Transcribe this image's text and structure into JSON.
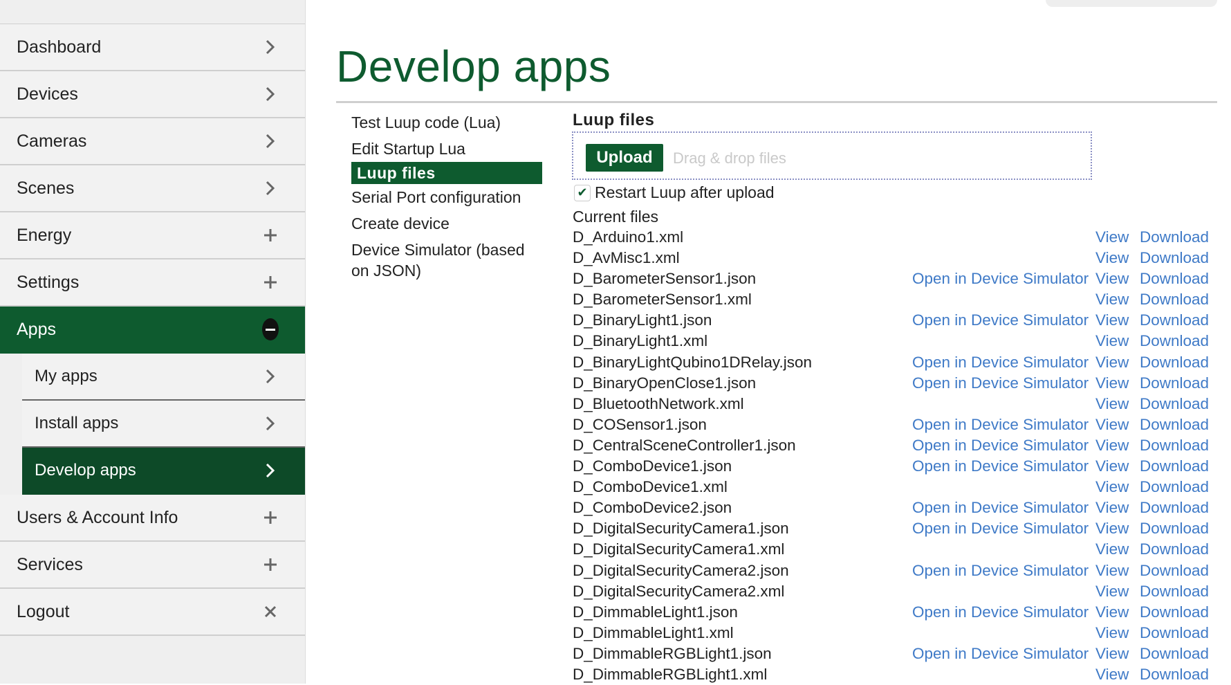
{
  "sidebar": {
    "items": [
      {
        "label": "Dashboard",
        "icon": "chevron-right-icon"
      },
      {
        "label": "Devices",
        "icon": "chevron-right-icon"
      },
      {
        "label": "Cameras",
        "icon": "chevron-right-icon"
      },
      {
        "label": "Scenes",
        "icon": "chevron-right-icon"
      },
      {
        "label": "Energy",
        "icon": "plus-icon"
      },
      {
        "label": "Settings",
        "icon": "plus-icon"
      },
      {
        "label": "Apps",
        "icon": "minus-circle-icon"
      },
      {
        "label": "My apps",
        "icon": "chevron-right-icon"
      },
      {
        "label": "Install apps",
        "icon": "chevron-right-icon"
      },
      {
        "label": "Develop apps",
        "icon": "chevron-right-icon"
      },
      {
        "label": "Users & Account Info",
        "icon": "plus-icon"
      },
      {
        "label": "Services",
        "icon": "plus-icon"
      },
      {
        "label": "Logout",
        "icon": "close-icon"
      }
    ]
  },
  "main": {
    "title": "Develop apps",
    "submenu": [
      "Test Luup code (Lua)",
      "Edit Startup Lua",
      "Luup files",
      "Serial Port configuration",
      "Create device",
      "Device Simulator (based on JSON)"
    ],
    "luup": {
      "heading": "Luup files",
      "upload_label": "Upload",
      "drop_hint": "Drag & drop files",
      "restart_label": "Restart Luup after upload",
      "restart_checked": true,
      "current_files_label": "Current files",
      "sim_link_label": "Open in Device Simulator",
      "view_label": "View",
      "download_label": "Download",
      "files": [
        {
          "name": "D_Arduino1.xml",
          "sim": false
        },
        {
          "name": "D_AvMisc1.xml",
          "sim": false
        },
        {
          "name": "D_BarometerSensor1.json",
          "sim": true
        },
        {
          "name": "D_BarometerSensor1.xml",
          "sim": false
        },
        {
          "name": "D_BinaryLight1.json",
          "sim": true
        },
        {
          "name": "D_BinaryLight1.xml",
          "sim": false
        },
        {
          "name": "D_BinaryLightQubino1DRelay.json",
          "sim": true
        },
        {
          "name": "D_BinaryOpenClose1.json",
          "sim": true
        },
        {
          "name": "D_BluetoothNetwork.xml",
          "sim": false
        },
        {
          "name": "D_COSensor1.json",
          "sim": true
        },
        {
          "name": "D_CentralSceneController1.json",
          "sim": true
        },
        {
          "name": "D_ComboDevice1.json",
          "sim": true
        },
        {
          "name": "D_ComboDevice1.xml",
          "sim": false
        },
        {
          "name": "D_ComboDevice2.json",
          "sim": true
        },
        {
          "name": "D_DigitalSecurityCamera1.json",
          "sim": true
        },
        {
          "name": "D_DigitalSecurityCamera1.xml",
          "sim": false
        },
        {
          "name": "D_DigitalSecurityCamera2.json",
          "sim": true
        },
        {
          "name": "D_DigitalSecurityCamera2.xml",
          "sim": false
        },
        {
          "name": "D_DimmableLight1.json",
          "sim": true
        },
        {
          "name": "D_DimmableLight1.xml",
          "sim": false
        },
        {
          "name": "D_DimmableRGBLight1.json",
          "sim": true
        },
        {
          "name": "D_DimmableRGBLight1.xml",
          "sim": false
        }
      ]
    }
  },
  "colors": {
    "brand_green": "#0e5b2f",
    "current_green": "#0d4a28",
    "link_blue": "#3f7ac7",
    "sidebar_bg": "#efefef"
  }
}
